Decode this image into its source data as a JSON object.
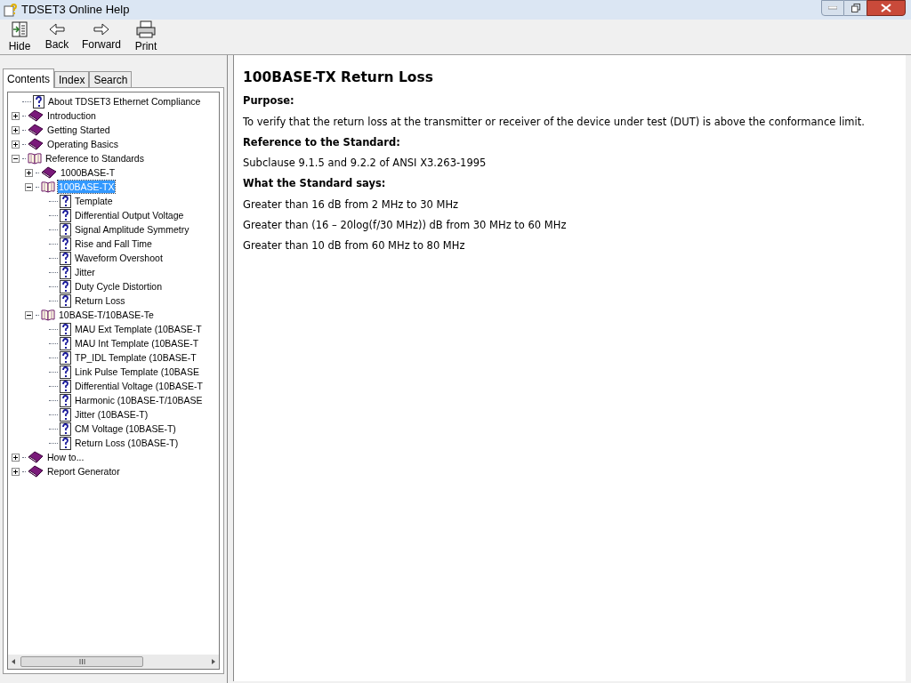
{
  "window": {
    "title": "TDSET3 Online Help"
  },
  "toolbar": [
    {
      "label": "Hide",
      "kind": "hide"
    },
    {
      "label": "Back",
      "kind": "back"
    },
    {
      "label": "Forward",
      "kind": "forward"
    },
    {
      "label": "Print",
      "kind": "print"
    }
  ],
  "tabs": [
    {
      "label": "Contents",
      "selected": true
    },
    {
      "label": "Index",
      "selected": false
    },
    {
      "label": "Search",
      "selected": false
    }
  ],
  "tree": [
    {
      "label": "About TDSET3 Ethernet Compliance",
      "kind": "page",
      "selected": false
    },
    {
      "label": "Introduction",
      "kind": "book",
      "expanded": false,
      "selected": false
    },
    {
      "label": "Getting Started",
      "kind": "book",
      "expanded": false,
      "selected": false
    },
    {
      "label": "Operating Basics",
      "kind": "book",
      "expanded": false,
      "selected": false
    },
    {
      "label": "Reference to Standards",
      "kind": "book",
      "expanded": true,
      "selected": false,
      "children": [
        {
          "label": "1000BASE-T",
          "kind": "book",
          "expanded": false,
          "selected": false
        },
        {
          "label": "100BASE-TX",
          "kind": "book",
          "expanded": true,
          "selected": true,
          "children": [
            {
              "label": "Template",
              "kind": "page",
              "selected": false
            },
            {
              "label": "Differential Output Voltage",
              "kind": "page",
              "selected": false
            },
            {
              "label": "Signal Amplitude Symmetry",
              "kind": "page",
              "selected": false
            },
            {
              "label": "Rise and Fall Time",
              "kind": "page",
              "selected": false
            },
            {
              "label": "Waveform Overshoot",
              "kind": "page",
              "selected": false
            },
            {
              "label": "Jitter",
              "kind": "page",
              "selected": false
            },
            {
              "label": "Duty Cycle Distortion",
              "kind": "page",
              "selected": false
            },
            {
              "label": "Return Loss",
              "kind": "page",
              "selected": false
            }
          ]
        },
        {
          "label": "10BASE-T/10BASE-Te",
          "kind": "book",
          "expanded": true,
          "selected": false,
          "children": [
            {
              "label": "MAU Ext Template (10BASE-T",
              "kind": "page",
              "selected": false
            },
            {
              "label": "MAU Int Template (10BASE-T",
              "kind": "page",
              "selected": false
            },
            {
              "label": "TP_IDL Template (10BASE-T",
              "kind": "page",
              "selected": false
            },
            {
              "label": "Link Pulse Template (10BASE",
              "kind": "page",
              "selected": false
            },
            {
              "label": "Differential Voltage (10BASE-T",
              "kind": "page",
              "selected": false
            },
            {
              "label": "Harmonic (10BASE-T/10BASE",
              "kind": "page",
              "selected": false
            },
            {
              "label": "Jitter (10BASE-T)",
              "kind": "page",
              "selected": false
            },
            {
              "label": "CM Voltage (10BASE-T)",
              "kind": "page",
              "selected": false
            },
            {
              "label": "Return Loss (10BASE-T)",
              "kind": "page",
              "selected": false
            }
          ]
        }
      ]
    },
    {
      "label": "How to...",
      "kind": "book",
      "expanded": false,
      "selected": false
    },
    {
      "label": "Report Generator",
      "kind": "book",
      "expanded": false,
      "selected": false
    }
  ],
  "article": {
    "title": "100BASE-TX Return Loss",
    "sections": [
      {
        "heading": "Purpose:",
        "paragraphs": [
          "To verify that the return loss at the transmitter or receiver of the device under test (DUT) is above the conformance limit."
        ]
      },
      {
        "heading": "Reference to the Standard:",
        "paragraphs": [
          "Subclause 9.1.5 and 9.2.2 of ANSI X3.263-1995"
        ]
      },
      {
        "heading": "What the Standard says:",
        "paragraphs": [
          "Greater than 16 dB from 2 MHz to 30 MHz",
          "Greater than (16 – 20log(f/30 MHz)) dB from 30 MHz to 60 MHz",
          "Greater than 10 dB from 60 MHz to 80 MHz"
        ]
      }
    ]
  }
}
